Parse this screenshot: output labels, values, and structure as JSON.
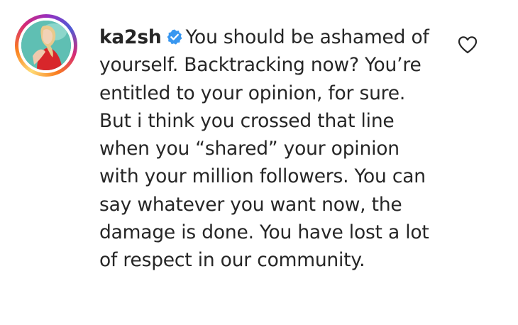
{
  "comment": {
    "username": "ka2sh",
    "text": "You should be ashamed of yourself. Backtracking now? You’re entitled to your opinion, for sure. But i think you crossed that line when you “shared” your opinion with your million followers. You can say whatever you want now, the damage is done. You have lost a lot of respect in our community.",
    "verified": true
  },
  "icons": {
    "verified": "verified-badge-icon",
    "like": "heart-outline-icon"
  },
  "colors": {
    "text": "#262626",
    "verified_badge": "#3897f0",
    "background": "#ffffff"
  }
}
